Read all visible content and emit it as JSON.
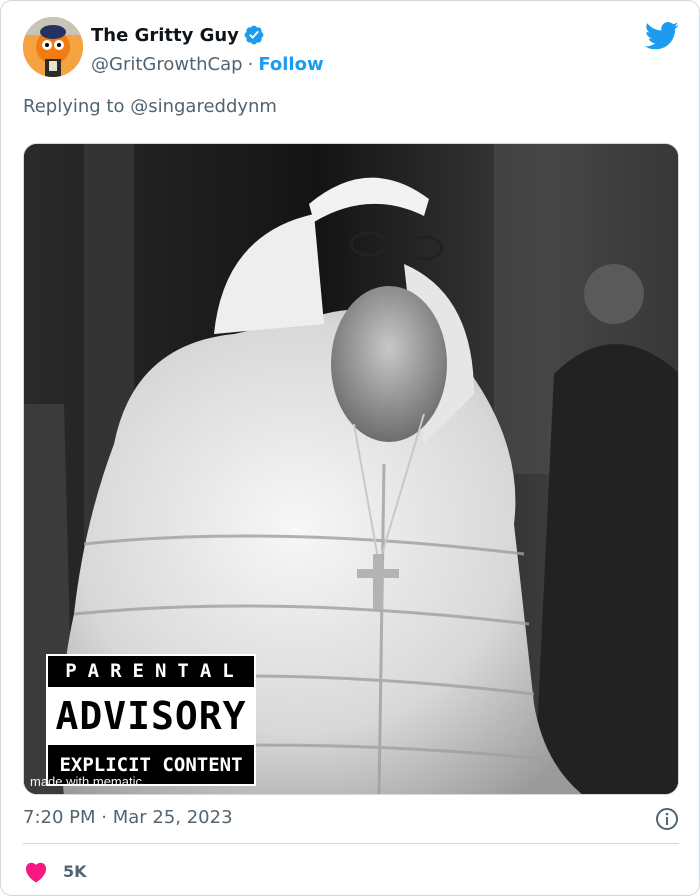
{
  "author": {
    "display_name": "The Gritty Guy",
    "handle": "@GritGrowthCap",
    "separator": "·",
    "follow_label": "Follow",
    "verified": true
  },
  "reply": {
    "text": "Replying to @singareddynm"
  },
  "media": {
    "advisory": {
      "top": "PARENTAL",
      "middle": "ADVISORY",
      "bottom": "EXPLICIT CONTENT"
    },
    "watermark": "made with mematic"
  },
  "meta": {
    "timestamp": "7:20 PM · Mar 25, 2023"
  },
  "engagement": {
    "likes": "5K"
  },
  "colors": {
    "brand_blue": "#1d9bf0",
    "like_red": "#f91880",
    "muted_text": "#536471"
  },
  "icons": [
    "twitter-bird-icon",
    "verified-badge-icon",
    "info-icon",
    "heart-icon"
  ]
}
